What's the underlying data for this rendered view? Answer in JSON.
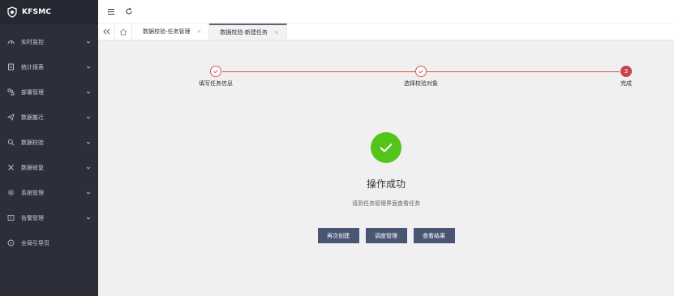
{
  "app": {
    "name": "KFSMC"
  },
  "sidebar": {
    "items": [
      {
        "label": "实时监控",
        "icon": "dashboard-icon",
        "expandable": true
      },
      {
        "label": "统计报表",
        "icon": "report-icon",
        "expandable": true
      },
      {
        "label": "部署管理",
        "icon": "deploy-icon",
        "expandable": true
      },
      {
        "label": "数据搬迁",
        "icon": "send-icon",
        "expandable": true
      },
      {
        "label": "数据校验",
        "icon": "search-icon",
        "expandable": true
      },
      {
        "label": "数据修复",
        "icon": "repair-icon",
        "expandable": true
      },
      {
        "label": "系统管理",
        "icon": "gear-icon",
        "expandable": true
      },
      {
        "label": "告警管理",
        "icon": "alarm-icon",
        "expandable": true
      },
      {
        "label": "全局引导页",
        "icon": "info-icon",
        "expandable": false
      }
    ]
  },
  "tabs": [
    {
      "label": "数据校验-任务管理",
      "active": false
    },
    {
      "label": "数据校验-新建任务",
      "active": true
    }
  ],
  "steps": [
    {
      "label": "填写任务信息",
      "state": "done"
    },
    {
      "label": "选择校验对象",
      "state": "done"
    },
    {
      "label": "完成",
      "state": "current",
      "number": "3"
    }
  ],
  "result": {
    "title": "操作成功",
    "subtitle": "请到任务管理界面查看任务",
    "buttons": [
      "再次创建",
      "调度管理",
      "查看结果"
    ]
  },
  "colors": {
    "sidebar_bg": "#2c2f3a",
    "accent_red": "#d9534f",
    "success_green": "#52c41a",
    "button_bg": "#4a5573"
  }
}
